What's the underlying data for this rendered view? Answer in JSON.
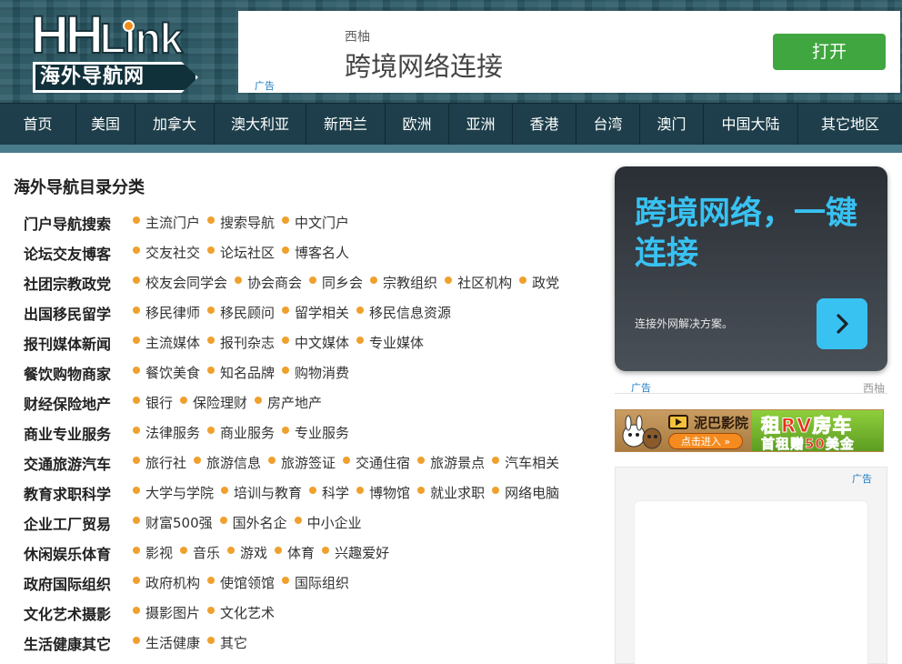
{
  "logo": {
    "main": "HHLink",
    "main_a": "HH",
    "main_b": "Link",
    "subtitle": "海外导航网"
  },
  "top_ad": {
    "brand": "西柚",
    "headline": "跨境网络连接",
    "tag": "广告",
    "button": "打开"
  },
  "nav": [
    "首页",
    "美国",
    "加拿大",
    "澳大利亚",
    "新西兰",
    "欧洲",
    "亚洲",
    "香港",
    "台湾",
    "澳门",
    "中国大陆",
    "其它地区"
  ],
  "directory": {
    "title": "海外导航目录分类",
    "rows": [
      {
        "category": "门户导航搜索",
        "links": [
          "主流门户",
          "搜索导航",
          "中文门户"
        ]
      },
      {
        "category": "论坛交友博客",
        "links": [
          "交友社交",
          "论坛社区",
          "博客名人"
        ]
      },
      {
        "category": "社团宗教政党",
        "links": [
          "校友会同学会",
          "协会商会",
          "同乡会",
          "宗教组织",
          "社区机构",
          "政党"
        ]
      },
      {
        "category": "出国移民留学",
        "links": [
          "移民律师",
          "移民顾问",
          "留学相关",
          "移民信息资源"
        ]
      },
      {
        "category": "报刊媒体新闻",
        "links": [
          "主流媒体",
          "报刊杂志",
          "中文媒体",
          "专业媒体"
        ]
      },
      {
        "category": "餐饮购物商家",
        "links": [
          "餐饮美食",
          "知名品牌",
          "购物消费"
        ]
      },
      {
        "category": "财经保险地产",
        "links": [
          "银行",
          "保险理财",
          "房产地产"
        ]
      },
      {
        "category": "商业专业服务",
        "links": [
          "法律服务",
          "商业服务",
          "专业服务"
        ]
      },
      {
        "category": "交通旅游汽车",
        "links": [
          "旅行社",
          "旅游信息",
          "旅游签证",
          "交通住宿",
          "旅游景点",
          "汽车相关"
        ]
      },
      {
        "category": "教育求职科学",
        "links": [
          "大学与学院",
          "培训与教育",
          "科学",
          "博物馆",
          "就业求职",
          "网络电脑"
        ]
      },
      {
        "category": "企业工厂贸易",
        "links": [
          "财富500强",
          "国外名企",
          "中小企业"
        ]
      },
      {
        "category": "休闲娱乐体育",
        "links": [
          "影视",
          "音乐",
          "游戏",
          "体育",
          "兴趣爱好"
        ]
      },
      {
        "category": "政府国际组织",
        "links": [
          "政府机构",
          "使馆领馆",
          "国际组织"
        ]
      },
      {
        "category": "文化艺术摄影",
        "links": [
          "摄影图片",
          "文化艺术"
        ]
      },
      {
        "category": "生活健康其它",
        "links": [
          "生活健康",
          "其它"
        ]
      }
    ]
  },
  "side_ad": {
    "headline": "跨境网络，一键连接",
    "sub": "连接外网解决方案。",
    "tag": "广告",
    "brand": "西柚"
  },
  "strip_ad": {
    "brand": "泥巴影院",
    "enter": "点击进入 »",
    "rv_line1": "租RV房车",
    "rv_line2": "首租赠50美金"
  },
  "box_ad": {
    "tag": "广告"
  },
  "colors": {
    "nav_bg": "#1d3e4a",
    "accent_blue": "#38c2f2",
    "dot_orange": "#f0a02c",
    "open_button": "#40a63f"
  }
}
